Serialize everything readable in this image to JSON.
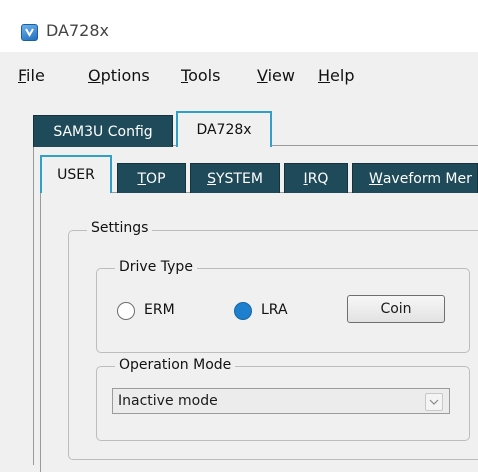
{
  "window": {
    "title": "DA728x"
  },
  "menu": [
    {
      "mnemonic": "F",
      "rest": "ile"
    },
    {
      "mnemonic": "O",
      "rest": "ptions"
    },
    {
      "mnemonic": "T",
      "rest": "ools"
    },
    {
      "mnemonic": "V",
      "rest": "iew"
    },
    {
      "mnemonic": "H",
      "rest": "elp"
    }
  ],
  "outer_tabs": [
    {
      "label": "SAM3U Config",
      "active": false
    },
    {
      "label": "DA728x",
      "active": true
    }
  ],
  "inner_tabs": [
    {
      "label": "USER",
      "active": true
    },
    {
      "mnemonic": "T",
      "rest": "OP",
      "active": false
    },
    {
      "mnemonic": "S",
      "rest": "YSTEM",
      "active": false
    },
    {
      "mnemonic": "I",
      "rest": "RQ",
      "active": false
    },
    {
      "mnemonic": "W",
      "rest": "aveform Mer",
      "active": false
    }
  ],
  "settings": {
    "label": "Settings",
    "drive_type": {
      "label": "Drive Type",
      "options": [
        {
          "label": "ERM",
          "selected": false
        },
        {
          "label": "LRA",
          "selected": true
        }
      ],
      "coin_button": "Coin"
    },
    "operation_mode": {
      "label": "Operation Mode",
      "value": "Inactive mode"
    }
  },
  "colors": {
    "tab_dark": "#1f4a5a",
    "accent": "#2fa0c8",
    "radio_selected": "#1e7fcf"
  }
}
